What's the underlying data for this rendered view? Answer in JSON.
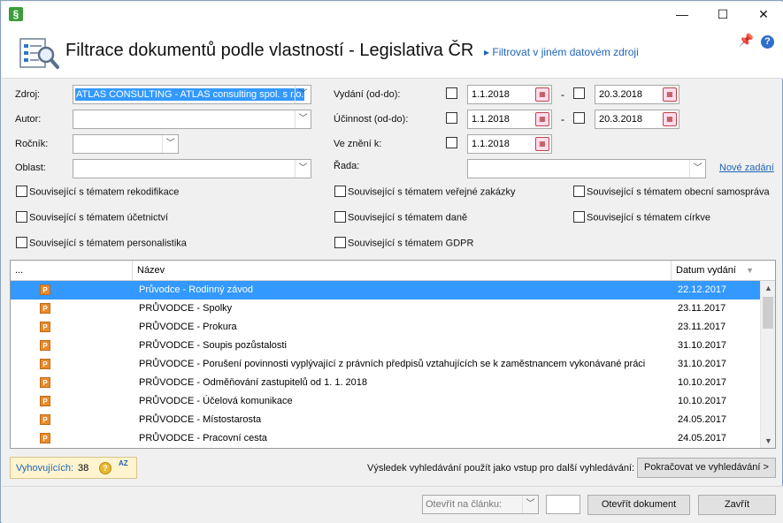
{
  "window": {
    "minimize": "—",
    "maximize": "☐",
    "close": "✕",
    "app_icon": "§"
  },
  "header": {
    "title": "Filtrace dokumentů podle vlastností - Legislativa ČR",
    "link_arrow": "▸",
    "link": "Filtrovat v jiném datovém zdroji",
    "pin_icon": "📌",
    "help_icon": "?"
  },
  "form": {
    "zdroj_label": "Zdroj:",
    "zdroj_value": "ATLAS CONSULTING - ATLAS consulting spol. s r.o.",
    "autor_label": "Autor:",
    "autor_value": "",
    "rocnik_label": "Ročník:",
    "rocnik_value": "",
    "oblast_label": "Oblast:",
    "oblast_value": "",
    "vydani_label": "Vydání (od-do):",
    "vydani_od": "1.1.2018",
    "vydani_do": "20.3.2018",
    "ucinnost_label": "Účinnost (od-do):",
    "ucinnost_od": "1.1.2018",
    "ucinnost_do": "20.3.2018",
    "zneni_label": "Ve znění k:",
    "zneni_value": "1.1.2018",
    "rada_label": "Řada:",
    "rada_value": "",
    "nove_zadani": "Nové zadání",
    "dash": "-",
    "dropdown_glyph": "﹀",
    "calendar_glyph": "▦"
  },
  "topics": [
    "Související s  tématem rekodifikace",
    "Související s tématem veřejné zakázky",
    "Související s tématem obecní samospráva",
    "Související s tématem  účetnictví",
    "Související s tématem  daně",
    "Související s tématem církve",
    "Související s tématem personalistika",
    "Související s tématem GDPR"
  ],
  "grid": {
    "columns": [
      "...",
      "Název",
      "Datum vydání"
    ],
    "sort_icon": "▼",
    "doc_icon_letter": "P",
    "rows": [
      {
        "name": "Průvodce - Rodinný závod",
        "date": "22.12.2017"
      },
      {
        "name": "PRŮVODCE - Spolky",
        "date": "23.11.2017"
      },
      {
        "name": "PRŮVODCE - Prokura",
        "date": "23.11.2017"
      },
      {
        "name": "PRŮVODCE - Soupis pozůstalosti",
        "date": "31.10.2017"
      },
      {
        "name": "PRŮVODCE - Porušení povinnosti vyplývající z právních předpisů vztahujících se k zaměstnancem vykonávané práci",
        "date": "31.10.2017"
      },
      {
        "name": "PRŮVODCE - Odměňování zastupitelů od 1. 1. 2018",
        "date": "10.10.2017"
      },
      {
        "name": "PRŮVODCE - Účelová komunikace",
        "date": "10.10.2017"
      },
      {
        "name": "PRŮVODCE - Místostarosta",
        "date": "24.05.2017"
      },
      {
        "name": "PRŮVODCE - Pracovní cesta",
        "date": "24.05.2017"
      }
    ],
    "scroll_up": "▲",
    "scroll_down": "▼"
  },
  "status": {
    "count_label": "Vyhovujících:",
    "count_value": "38",
    "info_icon": "?",
    "sort_az_icon": "AZ",
    "continue_text": "Výsledek vyhledávání použít jako vstup pro další vyhledávání:",
    "continue_button": "Pokračovat ve vyhledávání >"
  },
  "footer": {
    "open_at_placeholder": "Otevřít na článku:",
    "open_button": "Otevřít dokument",
    "close_button": "Zavřít"
  }
}
